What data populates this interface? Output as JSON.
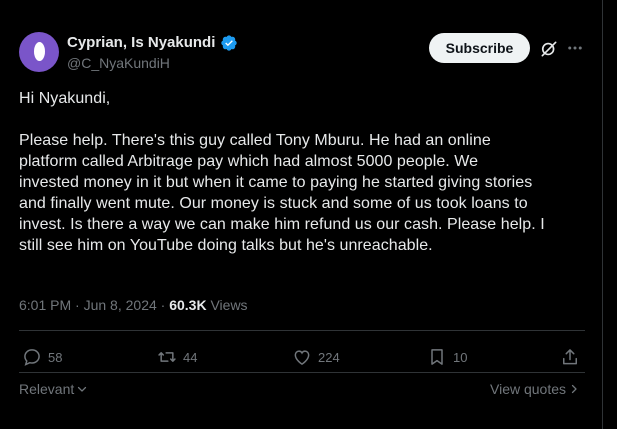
{
  "author": {
    "display_name": "Cyprian, Is Nyakundi",
    "handle": "@C_NyaKundiH",
    "verified_color": "#1d9bf0",
    "avatar_color": "#7a55c9"
  },
  "header": {
    "subscribe_label": "Subscribe"
  },
  "tweet": {
    "text": "Hi Nyakundi,\n\nPlease help. There's this guy called Tony Mburu. He had an online\nplatform called Arbitrage pay which had almost 5000 people. We\ninvested money in it but when it came to paying he started giving stories\nand finally went mute. Our money is stuck and some of us took loans to\ninvest. Is there a way we can make him refund us our cash. Please help. I\nstill see him on YouTube doing talks but he's unreachable.",
    "time": "6:01 PM",
    "separator": "·",
    "date": "Jun 8, 2024",
    "views_count": "60.3K",
    "views_label": "Views"
  },
  "actions": {
    "replies": "58",
    "reposts": "44",
    "likes": "224",
    "bookmarks": "10"
  },
  "footer": {
    "sort_label": "Relevant",
    "view_quotes_label": "View quotes"
  }
}
